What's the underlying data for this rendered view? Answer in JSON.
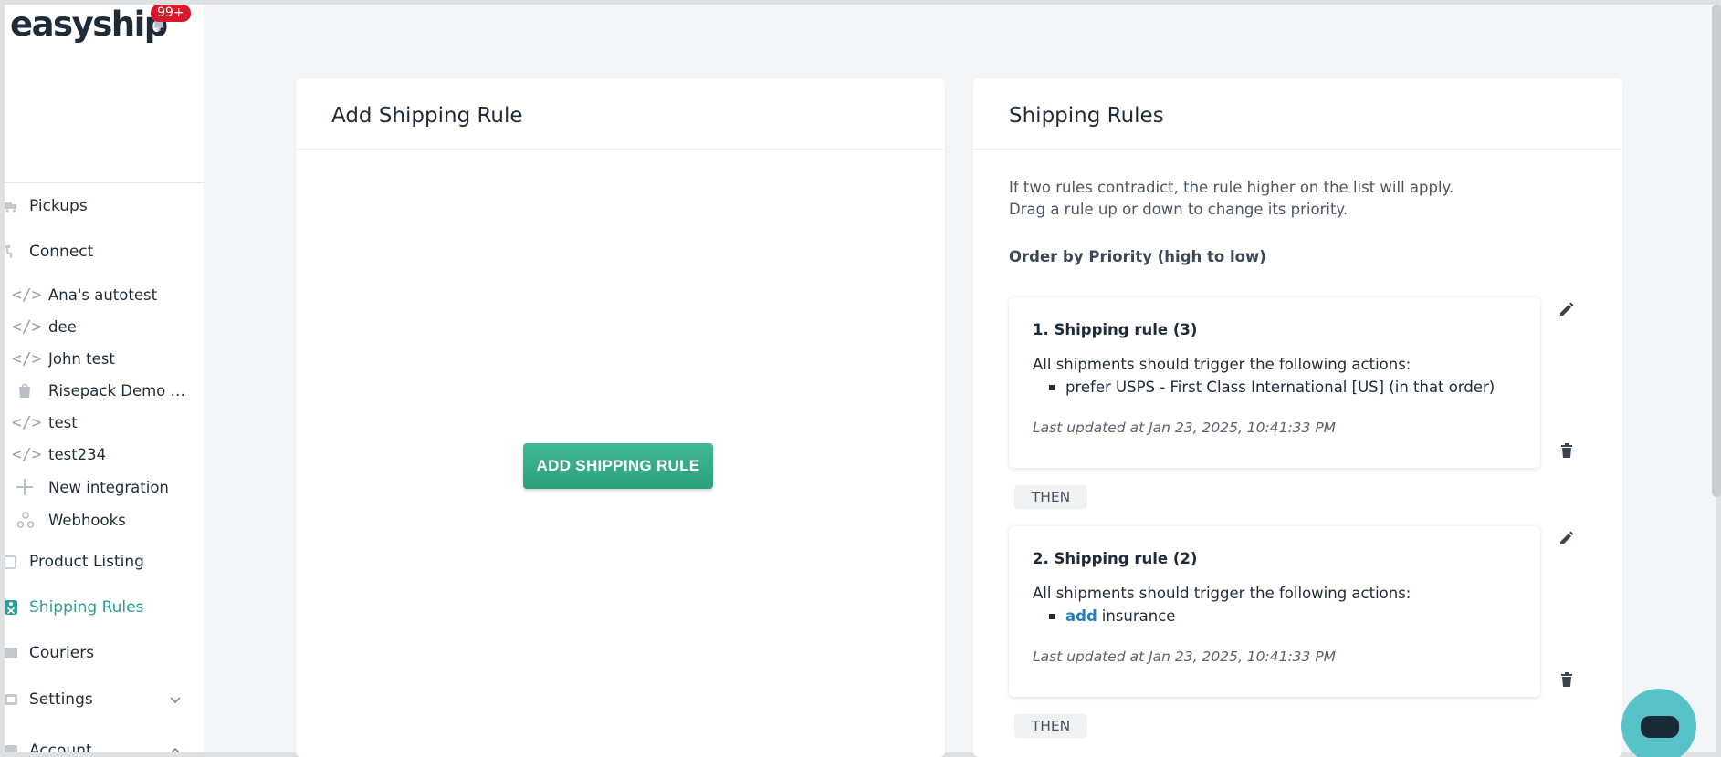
{
  "brand": {
    "logo": "easyship",
    "notifications_badge": "99+"
  },
  "sidebar": {
    "items": [
      {
        "label": "Pickups",
        "icon": "truck-icon"
      },
      {
        "label": "Connect",
        "icon": "plug-icon"
      },
      {
        "label": "Product Listing",
        "icon": "box-icon"
      },
      {
        "label": "Shipping Rules",
        "icon": "rules-icon",
        "active": true
      },
      {
        "label": "Couriers",
        "icon": "courier-icon"
      },
      {
        "label": "Settings",
        "icon": "settings-icon"
      },
      {
        "label": "Account",
        "icon": "account-icon"
      }
    ],
    "integrations": [
      {
        "label": "Ana's autotest",
        "icon": "code-icon"
      },
      {
        "label": "dee",
        "icon": "code-icon"
      },
      {
        "label": "John test",
        "icon": "code-icon"
      },
      {
        "label": "Risepack Demo Di...",
        "icon": "shopify-icon"
      },
      {
        "label": "test",
        "icon": "code-icon"
      },
      {
        "label": "test234",
        "icon": "code-icon"
      },
      {
        "label": "New integration",
        "icon": "plus-icon"
      },
      {
        "label": "Webhooks",
        "icon": "webhook-icon"
      }
    ]
  },
  "add_panel": {
    "title": "Add Shipping Rule",
    "button_label": "ADD SHIPPING RULE"
  },
  "rules_panel": {
    "title": "Shipping Rules",
    "help_line_1": "If two rules contradict, the rule higher on the list will apply.",
    "help_line_2": "Drag a rule up or down to change its priority.",
    "order_label": "Order by Priority (high to low)",
    "then_label": "THEN",
    "rules": [
      {
        "title": "1. Shipping rule (3)",
        "description": "All shipments should trigger the following actions:",
        "action_link": "",
        "action_text": "prefer USPS - First Class International [US] (in that order)",
        "updated": "Last updated at Jan 23, 2025, 10:41:33 PM"
      },
      {
        "title": "2. Shipping rule (2)",
        "description": "All shipments should trigger the following actions:",
        "action_link": "add",
        "action_text": "insurance",
        "updated": "Last updated at Jan 23, 2025, 10:41:33 PM"
      }
    ]
  },
  "colors": {
    "accent": "#2f9c97",
    "button": "#2aa17b",
    "link": "#1f7fbf",
    "badge": "#d71a2b",
    "chat": "#58c2c9"
  }
}
